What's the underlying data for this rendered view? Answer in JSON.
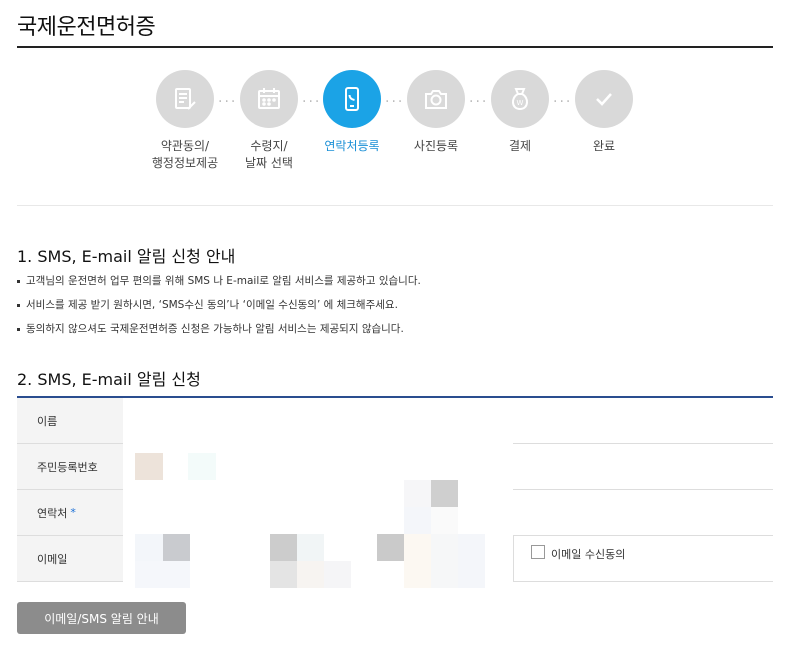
{
  "page": {
    "title": "국제운전면허증"
  },
  "steps": [
    {
      "label": "약관동의/\n행정정보제공",
      "icon": "document-edit-icon",
      "active": false
    },
    {
      "label": "수령지/\n날짜 선택",
      "icon": "calendar-icon",
      "active": false
    },
    {
      "label": "연락처등록",
      "icon": "phone-icon",
      "active": true
    },
    {
      "label": "사진등록",
      "icon": "camera-icon",
      "active": false
    },
    {
      "label": "결제",
      "icon": "money-bag-icon",
      "active": false
    },
    {
      "label": "완료",
      "icon": "check-icon",
      "active": false
    }
  ],
  "section1": {
    "heading": "1. SMS, E-mail 알림 신청 안내",
    "notices": [
      "고객님의 운전면허 업무 편의를 위해 SMS 나 E-mail로 알림 서비스를 제공하고 있습니다.",
      "서비스를 제공 받기 원하시면, ‘SMS수신 동의’나 ‘이메일 수신동의’ 에 체크해주세요.",
      "동의하지 않으셔도 국제운전면허증 신청은 가능하나 알림 서비스는 제공되지 않습니다."
    ]
  },
  "section2": {
    "heading": "2. SMS, E-mail 알림 신청",
    "fields": {
      "name": {
        "label": "이름"
      },
      "rrn": {
        "label": "주민등록번호"
      },
      "phone": {
        "label": "연락처",
        "required_mark": "*"
      },
      "email": {
        "label": "이메일",
        "consent_label": "이메일 수신동의",
        "consent_checked": false
      }
    }
  },
  "buttons": {
    "guide_label": "이메일/SMS 알림 안내"
  },
  "colors": {
    "accent": "#1ba3e6",
    "step_inactive": "#d9d9d9",
    "form_rule": "#2a4d8f",
    "button_bg": "#8c8c8c"
  }
}
